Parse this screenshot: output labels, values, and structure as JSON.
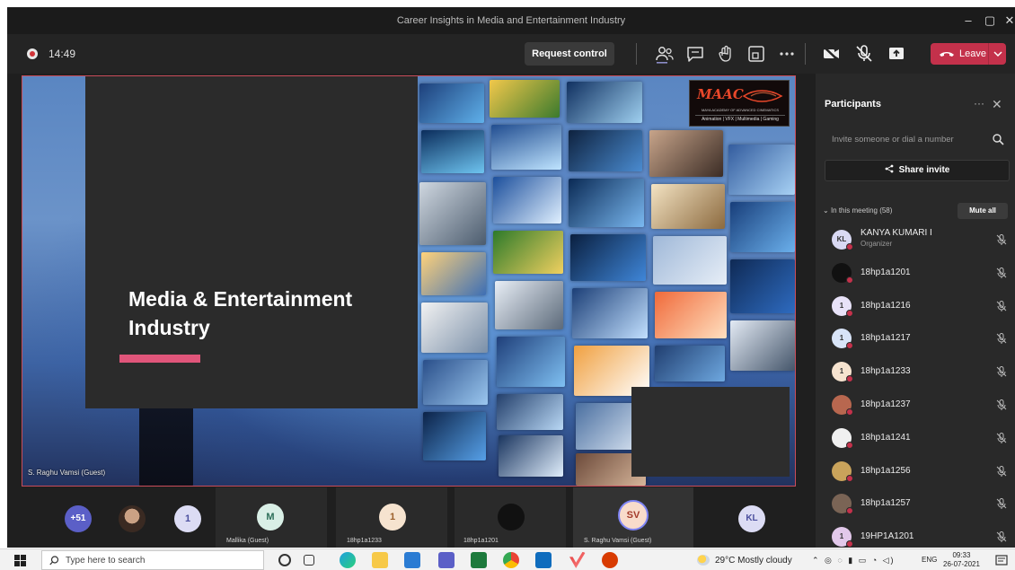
{
  "window": {
    "title": "Career Insights in Media and Entertainment Industry"
  },
  "toolbar": {
    "timer": "14:49",
    "request_control": "Request control",
    "leave": "Leave"
  },
  "slide": {
    "title_line1": "Media & Entertainment",
    "title_line2": "Industry",
    "logo_mark": "MAAC",
    "logo_tagline": "MAYA ACADEMY OF ADVANCED CINEMATICS",
    "logo_subtags": "Animation | VFX | Multimedia | Gaming",
    "presenter_label": "S. Raghu Vamsi (Guest)"
  },
  "strip": {
    "overflow_count": "+51",
    "tiles": [
      {
        "initials": "1",
        "label": ""
      },
      {
        "initials": "M",
        "label": "Mallika (Guest)"
      },
      {
        "initials": "1",
        "label": "18hp1a1233"
      },
      {
        "initials": "",
        "label": "18hp1a1201"
      },
      {
        "initials": "SV",
        "label": "S. Raghu Vamsi (Guest)"
      },
      {
        "initials": "KL",
        "label": ""
      }
    ]
  },
  "panel": {
    "title": "Participants",
    "invite_placeholder": "Invite someone or dial a number",
    "share_invite": "Share invite",
    "in_meeting": "In this meeting (58)",
    "mute_all": "Mute all",
    "participants": [
      {
        "initials": "KL",
        "name": "KANYA KUMARI I",
        "role": "Organizer",
        "color": "#d9d9f3"
      },
      {
        "initials": "",
        "name": "18hp1a1201",
        "role": "",
        "color": "#111111"
      },
      {
        "initials": "1",
        "name": "18hp1a1216",
        "role": "",
        "color": "#e8e2f8"
      },
      {
        "initials": "1",
        "name": "18hp1a1217",
        "role": "",
        "color": "#d8e4f8"
      },
      {
        "initials": "1",
        "name": "18hp1a1233",
        "role": "",
        "color": "#f6e3cf"
      },
      {
        "initials": "",
        "name": "18hp1a1237",
        "role": "",
        "color": "#b8674f"
      },
      {
        "initials": "",
        "name": "18hp1a1241",
        "role": "",
        "color": "#f0f0f0"
      },
      {
        "initials": "",
        "name": "18hp1a1256",
        "role": "",
        "color": "#c9a35b"
      },
      {
        "initials": "",
        "name": "18hp1a1257",
        "role": "",
        "color": "#7a6455"
      },
      {
        "initials": "1",
        "name": "19HP1A1201",
        "role": "",
        "color": "#e2c8ea"
      }
    ]
  },
  "taskbar": {
    "search_placeholder": "Type here to search",
    "weather": "29°C  Mostly cloudy",
    "language": "ENG",
    "time": "09:33",
    "date": "26-07-2021"
  },
  "colors": {
    "leave": "#c4314b",
    "accent_bar": "#e0557a",
    "organizer_status": "#c4314b"
  }
}
